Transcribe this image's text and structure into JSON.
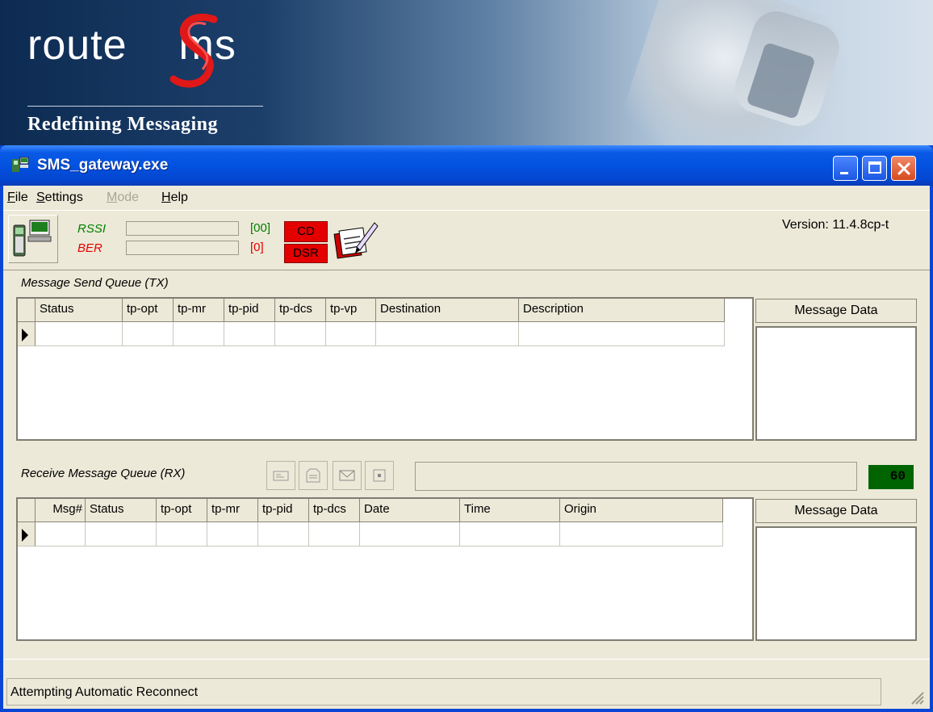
{
  "banner": {
    "logo_left": "route",
    "logo_right": "ms",
    "tagline": "Redefining Messaging"
  },
  "window": {
    "title": "SMS_gateway.exe",
    "buttons": [
      "minimize",
      "maximize",
      "close"
    ]
  },
  "menu": [
    {
      "label": "File",
      "enabled": true
    },
    {
      "label": "Settings",
      "enabled": true
    },
    {
      "label": "Mode",
      "enabled": false
    },
    {
      "label": "Help",
      "enabled": true
    }
  ],
  "toolbar": {
    "rssi_label": "RSSI",
    "rssi_value": "[00]",
    "ber_label": "BER",
    "ber_value": "[0]",
    "cd_label": "CD",
    "dsr_label": "DSR",
    "version": "Version: 11.4.8cp-t"
  },
  "tx": {
    "title": "Message Send Queue (TX)",
    "columns": [
      "Status",
      "tp-opt",
      "tp-mr",
      "tp-pid",
      "tp-dcs",
      "tp-vp",
      "Destination",
      "Description"
    ],
    "message_data_label": "Message Data"
  },
  "rx": {
    "title": "Receive Message Queue (RX)",
    "counter": "60",
    "columns": [
      "Msg#",
      "Status",
      "tp-opt",
      "tp-mr",
      "tp-pid",
      "tp-dcs",
      "Date",
      "Time",
      "Origin"
    ],
    "message_data_label": "Message Data"
  },
  "status": {
    "text": "Attempting Automatic Reconnect"
  },
  "colors": {
    "titlebar": "#0352e0",
    "client_bg": "#ece9d8",
    "indicator_red": "#e40000",
    "counter_green": "#006400",
    "rssi_green": "#008000",
    "ber_red": "#e40000"
  }
}
